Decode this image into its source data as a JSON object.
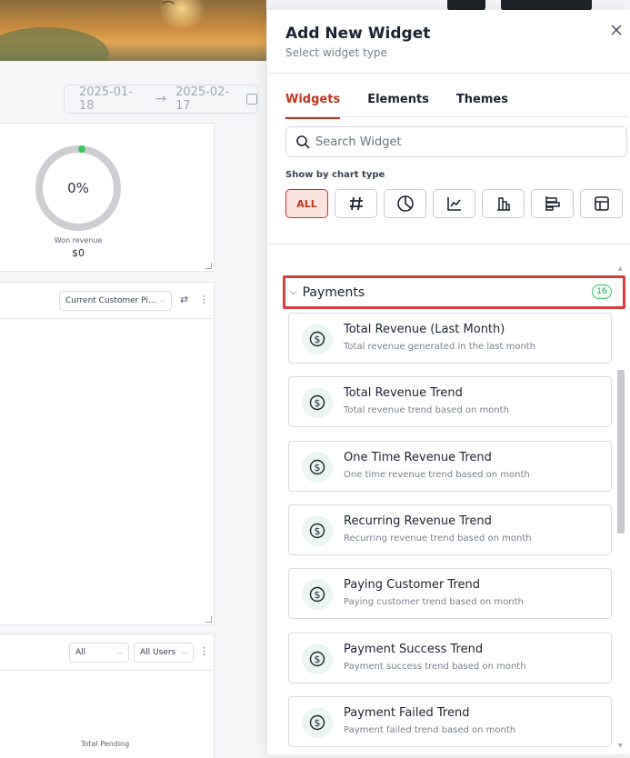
{
  "dashboard": {
    "date_start": "2025-01-18",
    "date_end": "2025-02-17",
    "card1": {
      "percent": "0%",
      "won_label": "Won revenue",
      "won_value": "$0"
    },
    "card2": {
      "select_value": "Current Customer Pi..."
    },
    "card3": {
      "filter_a": "All",
      "filter_b": "All Users",
      "footer_label": "Total Pending"
    }
  },
  "drawer": {
    "title": "Add New Widget",
    "subtitle": "Select widget type",
    "tabs": [
      {
        "label": "Widgets",
        "active": true
      },
      {
        "label": "Elements",
        "active": false
      },
      {
        "label": "Themes",
        "active": false
      }
    ],
    "search_placeholder": "Search Widget",
    "show_by_label": "Show by chart type",
    "chart_types": [
      {
        "label": "ALL",
        "icon": "all",
        "active": true
      },
      {
        "label": "",
        "icon": "hash-icon",
        "active": false
      },
      {
        "label": "",
        "icon": "pie-chart-icon",
        "active": false
      },
      {
        "label": "",
        "icon": "line-chart-icon",
        "active": false
      },
      {
        "label": "",
        "icon": "bar-chart-icon",
        "active": false
      },
      {
        "label": "",
        "icon": "horizontal-bar-icon",
        "active": false
      },
      {
        "label": "",
        "icon": "table-icon",
        "active": false
      }
    ],
    "group": {
      "name": "Payments",
      "count": "16"
    },
    "items": [
      {
        "title": "Total Revenue (Last Month)",
        "subtitle": "Total revenue generated in the last month"
      },
      {
        "title": "Total Revenue Trend",
        "subtitle": "Total revenue trend based on month"
      },
      {
        "title": "One Time Revenue Trend",
        "subtitle": "One time revenue trend based on month"
      },
      {
        "title": "Recurring Revenue Trend",
        "subtitle": "Recurring revenue trend based on month"
      },
      {
        "title": "Paying Customer Trend",
        "subtitle": "Paying customer trend based on month"
      },
      {
        "title": "Payment Success Trend",
        "subtitle": "Payment success trend based on month"
      },
      {
        "title": "Payment Failed Trend",
        "subtitle": "Payment failed trend based on month"
      }
    ]
  },
  "colors": {
    "accent": "#c4351f",
    "highlight_border": "#d93c3c",
    "count_green": "#2ea862"
  }
}
